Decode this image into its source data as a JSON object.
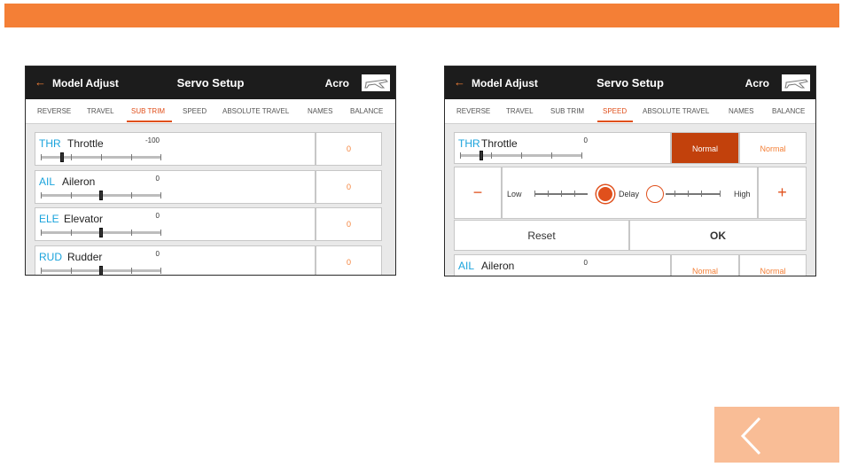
{
  "colors": {
    "accent": "#f47f36",
    "channel": "#1aa3dc",
    "header_bg": "#1c1c1c",
    "active_button": "#c2410c"
  },
  "screen1": {
    "header": {
      "back_label": "Model Adjust",
      "title": "Servo Setup",
      "model": "Acro",
      "model_icon": "airplane-icon"
    },
    "tabs": [
      "REVERSE",
      "TRAVEL",
      "SUB TRIM",
      "SPEED",
      "ABSOLUTE TRAVEL",
      "NAMES",
      "BALANCE"
    ],
    "active_tab": "SUB TRIM",
    "rows": [
      {
        "ch": "THR",
        "name": "Throttle",
        "value": "-100",
        "right": "0",
        "thumb_position": 0.175
      },
      {
        "ch": "AIL",
        "name": "Aileron",
        "value": "0",
        "right": "0",
        "thumb_position": 0.5
      },
      {
        "ch": "ELE",
        "name": "Elevator",
        "value": "0",
        "right": "0",
        "thumb_position": 0.5
      },
      {
        "ch": "RUD",
        "name": "Rudder",
        "value": "0",
        "right": "0",
        "thumb_position": 0.5
      }
    ]
  },
  "screen2": {
    "header": {
      "back_label": "Model Adjust",
      "title": "Servo Setup",
      "model": "Acro",
      "model_icon": "airplane-icon"
    },
    "tabs": [
      "REVERSE",
      "TRAVEL",
      "SUB TRIM",
      "SPEED",
      "ABSOLUTE TRAVEL",
      "NAMES",
      "BALANCE"
    ],
    "active_tab": "SPEED",
    "throttle": {
      "ch": "THR",
      "name": "Throttle",
      "value": "0",
      "btn1": "Normal",
      "btn2": "Normal",
      "thumb_position": 0.175
    },
    "editor": {
      "minus": "−",
      "plus": "+",
      "low": "Low",
      "delay": "Delay",
      "high": "High"
    },
    "reset": "Reset",
    "ok": "OK",
    "aileron": {
      "ch": "AIL",
      "name": "Aileron",
      "value": "0",
      "btn1": "Normal",
      "btn2": "Normal"
    }
  }
}
